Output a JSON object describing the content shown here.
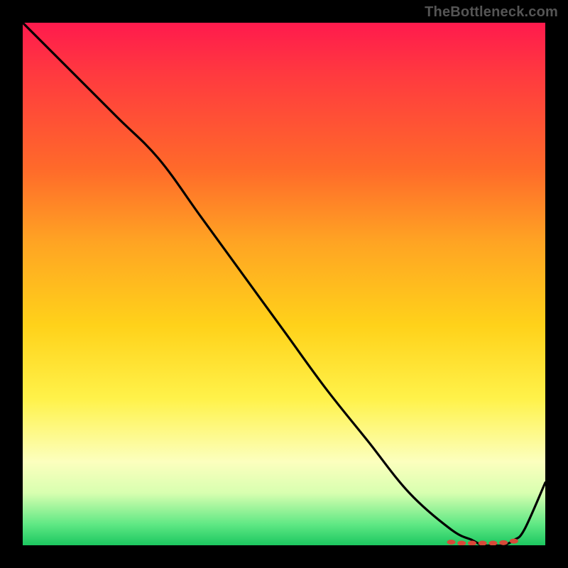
{
  "attribution": "TheBottleneck.com",
  "chart_data": {
    "type": "line",
    "title": "",
    "xlabel": "",
    "ylabel": "",
    "xlim": [
      0,
      100
    ],
    "ylim": [
      0,
      100
    ],
    "grid": false,
    "legend": false,
    "series": [
      {
        "name": "main-curve",
        "x": [
          0,
          8,
          18,
          26,
          34,
          42,
          50,
          58,
          66,
          74,
          82,
          86,
          88,
          90,
          92,
          94,
          96,
          100
        ],
        "values": [
          100,
          92,
          82,
          74,
          63,
          52,
          41,
          30,
          20,
          10,
          3,
          1,
          0,
          0,
          0,
          1,
          3,
          12
        ]
      }
    ],
    "markers": {
      "name": "bottom-dots",
      "color": "#d84a3a",
      "x": [
        82,
        84,
        86,
        88,
        90,
        92,
        94
      ],
      "values": [
        0.6,
        0.4,
        0.4,
        0.4,
        0.4,
        0.5,
        0.8
      ]
    }
  }
}
